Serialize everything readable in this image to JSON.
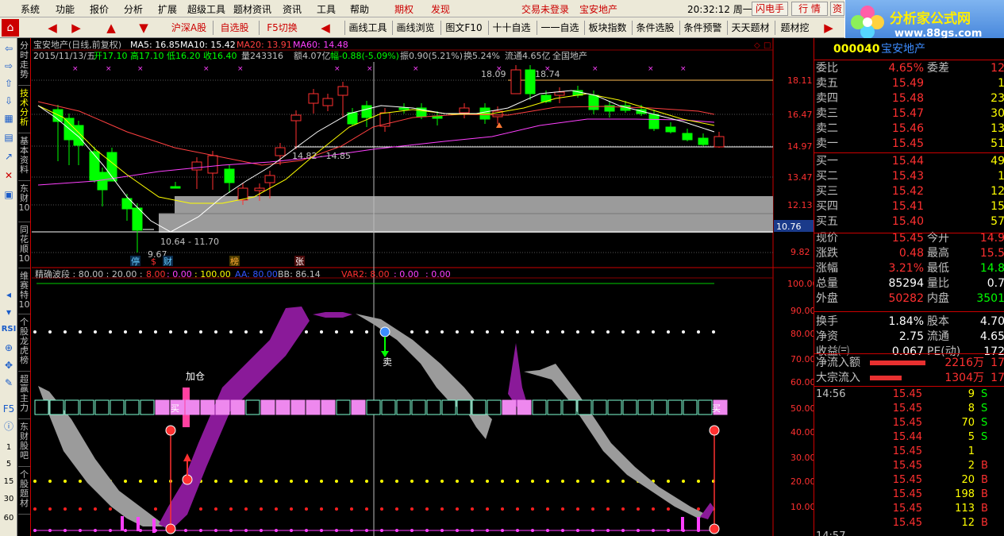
{
  "menubar": {
    "items": [
      "系统",
      "功能",
      "报价",
      "分析",
      "扩展",
      "超级工具",
      "题材资讯",
      "资讯",
      "工具",
      "帮助"
    ],
    "red_items": [
      "期权",
      "发现"
    ],
    "login_status": "交易未登录",
    "stock_link": "宝安地产",
    "clock": "20:32:12 周一",
    "buttons": [
      "闪电手",
      "行 情",
      "资"
    ]
  },
  "toolbar": {
    "items": [
      "沪深A股",
      "自选股",
      "F5切换",
      "画线工具",
      "画线浏览",
      "图文F10",
      "十十自选",
      "一一自选",
      "板块指数",
      "条件选股",
      "条件预警",
      "天天题材",
      "题材挖"
    ]
  },
  "logo": {
    "title": "分析家公式网",
    "url": "www.88gs.com"
  },
  "leftbar": {
    "numbers": [
      "1",
      "5",
      "15",
      "30",
      "60"
    ],
    "rsi": "RSI"
  },
  "vtabs": [
    "分时走势",
    "技术分析",
    "基本资料",
    "东财10",
    "同花顺10",
    "维赛特10",
    "个股龙虎榜",
    "超赢主力",
    "东财股吧",
    "个股题材"
  ],
  "chart": {
    "header": {
      "title": "宝安地产(日线,前复权)",
      "ma5": "MA5: 16.85",
      "ma10": "MA10: 15.42",
      "ma20": "MA20: 13.91",
      "ma60": "MA60: 14.48",
      "date": "2015/11/13/五",
      "open": "开17.10",
      "high": "高17.10",
      "low": "低16.20",
      "close": "收16.40",
      "vol": "量243316",
      "amt": "额4.07亿",
      "change": "幅-0.88(-5.09%)",
      "swing": "振0.90(5.21%)",
      "turnover": "换5.24%",
      "float": "流通4.65亿",
      "sector": "全国地产"
    },
    "price_axis": [
      "18.11",
      "16.47",
      "14.97",
      "13.47",
      "12.13",
      "10.76",
      "9.82"
    ],
    "annotations": {
      "high_left": "18.09",
      "high_right": "18.74",
      "band_mid": "14.82 - 14.85",
      "band_low": "10.64 - 11.70",
      "low": "9.67"
    },
    "markers": [
      "停",
      "$",
      "财",
      "榜",
      "张"
    ],
    "indicator_header": {
      "name": "精确波段 : 80.00 : 20.00 :",
      "v1": "8.00",
      "v2": ": 0.00",
      "v3": ": 100.00",
      "aa": "AA: 80.00",
      "bb": "BB: 86.14",
      "var2": "VAR2: 8.00",
      "v4": ": 0.00",
      "v5": ": 0.00"
    },
    "ind_axis": [
      "100.00",
      "90.00",
      "80.00",
      "70.00",
      "60.00",
      "50.00",
      "40.00",
      "30.00",
      "20.00",
      "10.00"
    ],
    "ind_labels": {
      "add": "加仓",
      "buy": "买",
      "sell": "卖",
      "buy2": "买"
    },
    "colors": {
      "up": "#ff3030",
      "down": "#00ff00",
      "ma5": "#ffffff",
      "ma10": "#ffff00",
      "ma20": "#ff4040",
      "ma60": "#ff40ff",
      "band": "#9b9b9b",
      "purple": "#8a1a99"
    }
  },
  "quote": {
    "code": "000040",
    "name": "宝安地产",
    "rows": [
      {
        "l": "委比",
        "v": "4.65%",
        "l2": "委差",
        "v2": "12"
      },
      {
        "l": "卖五",
        "v": "15.49",
        "v2": "1"
      },
      {
        "l": "卖四",
        "v": "15.48",
        "v2": "23"
      },
      {
        "l": "卖三",
        "v": "15.47",
        "v2": "30"
      },
      {
        "l": "卖二",
        "v": "15.46",
        "v2": "13"
      },
      {
        "l": "卖一",
        "v": "15.45",
        "v2": "51"
      },
      {
        "l": "买一",
        "v": "15.44",
        "v2": "49"
      },
      {
        "l": "买二",
        "v": "15.43",
        "v2": "1"
      },
      {
        "l": "买三",
        "v": "15.42",
        "v2": "12"
      },
      {
        "l": "买四",
        "v": "15.41",
        "v2": "15"
      },
      {
        "l": "买五",
        "v": "15.40",
        "v2": "57"
      },
      {
        "l": "现价",
        "v": "15.45",
        "l2": "今开",
        "v2": "14.9"
      },
      {
        "l": "涨跌",
        "v": "0.48",
        "l2": "最高",
        "v2": "15.5"
      },
      {
        "l": "涨幅",
        "v": "3.21%",
        "l2": "最低",
        "v2": "14.8"
      },
      {
        "l": "总量",
        "v": "85294",
        "l2": "量比",
        "v2": "0.7"
      },
      {
        "l": "外盘",
        "v": "50282",
        "l2": "内盘",
        "v2": "3501"
      },
      {
        "l": "换手",
        "v": "1.84%",
        "l2": "股本",
        "v2": "4.70"
      },
      {
        "l": "净资",
        "v": "2.75",
        "l2": "流通",
        "v2": "4.65"
      },
      {
        "l": "收益㈢",
        "v": "0.067",
        "l2": "PE(动)",
        "v2": "172"
      }
    ],
    "flow": [
      {
        "l": "净流入额",
        "v": "2216万",
        "v2": "17"
      },
      {
        "l": "大宗流入",
        "v": "1304万",
        "v2": "17"
      }
    ],
    "ticks": [
      {
        "t": "14:56",
        "p": "15.45",
        "n": "9",
        "s": "S"
      },
      {
        "t": "",
        "p": "15.45",
        "n": "8",
        "s": "S"
      },
      {
        "t": "",
        "p": "15.45",
        "n": "70",
        "s": "S"
      },
      {
        "t": "",
        "p": "15.44",
        "n": "5",
        "s": "S"
      },
      {
        "t": "",
        "p": "15.45",
        "n": "1",
        "s": ""
      },
      {
        "t": "",
        "p": "15.45",
        "n": "2",
        "s": "B"
      },
      {
        "t": "",
        "p": "15.45",
        "n": "20",
        "s": "B"
      },
      {
        "t": "",
        "p": "15.45",
        "n": "198",
        "s": "B"
      },
      {
        "t": "",
        "p": "15.45",
        "n": "113",
        "s": "B"
      },
      {
        "t": "",
        "p": "15.45",
        "n": "12",
        "s": "B"
      }
    ],
    "last_time": "14:57"
  }
}
